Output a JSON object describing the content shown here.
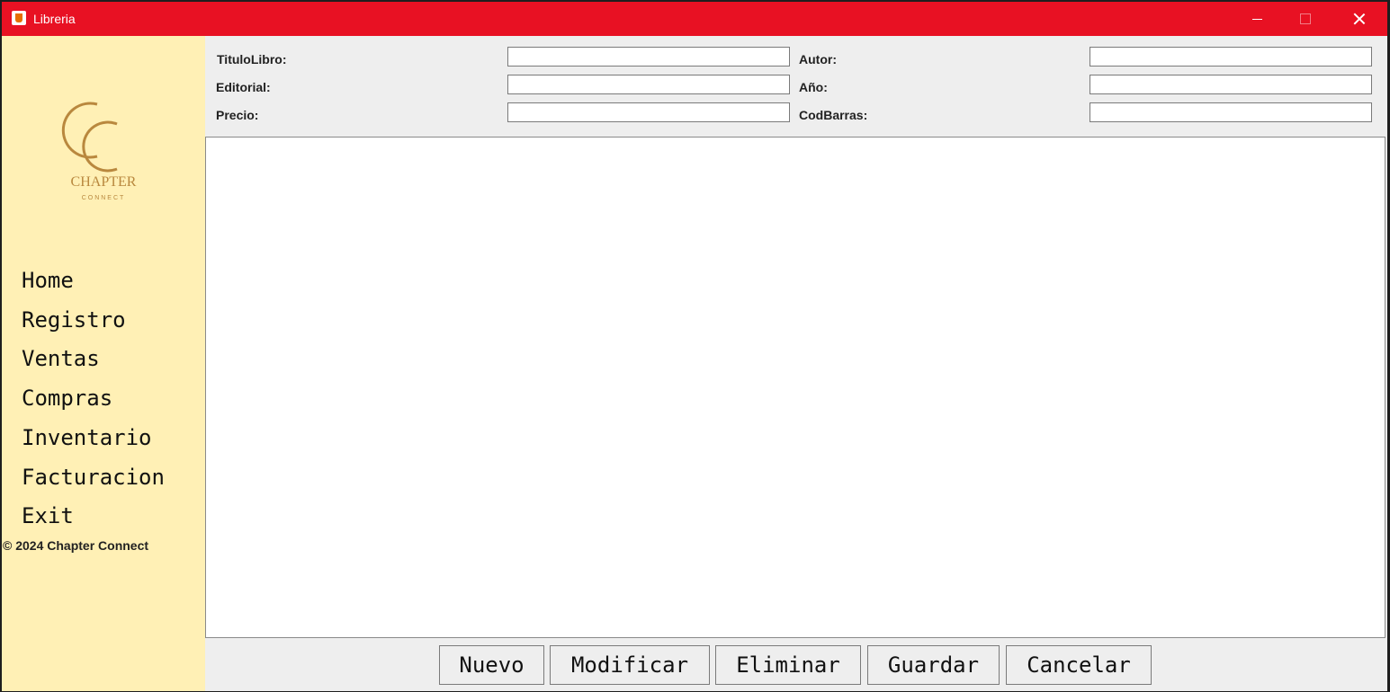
{
  "window": {
    "title": "Libreria",
    "controls": [
      "minimize-icon",
      "maximize-icon",
      "close-icon"
    ],
    "titlebar_color": "#e81123"
  },
  "sidebar": {
    "background": "#fff0b5",
    "logo": {
      "text": "CHAPTER",
      "subtext": "CONNECT",
      "color": "#b9883e"
    },
    "items": [
      {
        "label": "Home"
      },
      {
        "label": "Registro"
      },
      {
        "label": "Ventas"
      },
      {
        "label": "Compras"
      },
      {
        "label": "Inventario"
      },
      {
        "label": "Facturacion"
      },
      {
        "label": "Exit"
      }
    ],
    "copyright": "© 2024 Chapter Connect"
  },
  "form": {
    "titulo_label": "TituloLibro:",
    "titulo_value": "",
    "autor_label": "Autor:",
    "autor_value": "",
    "editorial_label": "Editorial:",
    "editorial_value": "",
    "anio_label": "Año:",
    "anio_value": "",
    "precio_label": "Precio:",
    "precio_value": "",
    "codbarras_label": "CodBarras:",
    "codbarras_value": ""
  },
  "actions": {
    "nuevo": "Nuevo",
    "modificar": "Modificar",
    "eliminar": "Eliminar",
    "guardar": "Guardar",
    "cancelar": "Cancelar"
  }
}
